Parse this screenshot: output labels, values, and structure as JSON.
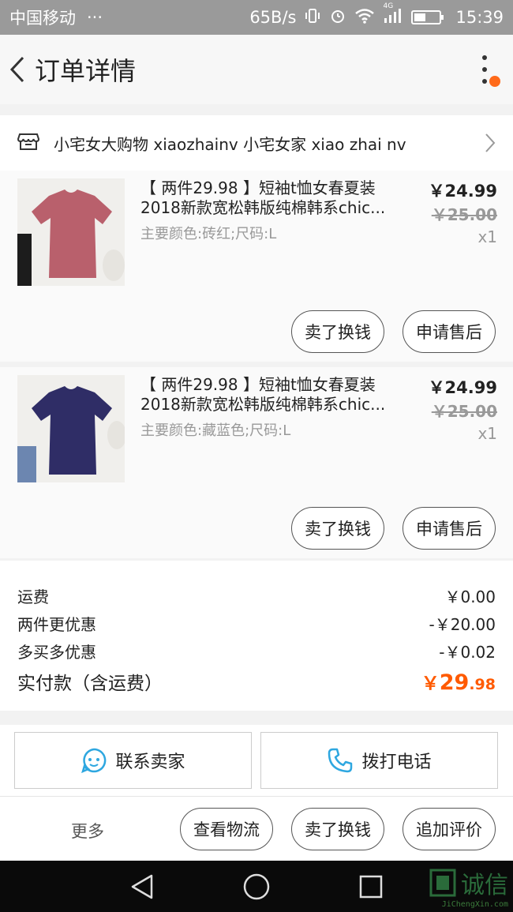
{
  "status_bar": {
    "carrier": "中国移动",
    "dots": "···",
    "speed": "65B/s",
    "network": "4G",
    "time": "15:39"
  },
  "header": {
    "title": "订单详情"
  },
  "shop": {
    "name": "小宅女大购物 xiaozhainv 小宅女家 xiao zhai nv"
  },
  "items": [
    {
      "title_line1": "【 两件29.98 】短袖t恤女春夏装",
      "title_line2": "2018新款宽松韩版纯棉韩系chic...",
      "sku": "主要颜色:砖红;尺码:L",
      "price": "￥24.99",
      "original_price": "￥25.00",
      "quantity": "x1",
      "shirt_color": "#b9606c",
      "btn_sell": "卖了换钱",
      "btn_aftersale": "申请售后"
    },
    {
      "title_line1": "【 两件29.98 】短袖t恤女春夏装",
      "title_line2": "2018新款宽松韩版纯棉韩系chic...",
      "sku": "主要颜色:藏蓝色;尺码:L",
      "price": "￥24.99",
      "original_price": "￥25.00",
      "quantity": "x1",
      "shirt_color": "#2f2d66",
      "btn_sell": "卖了换钱",
      "btn_aftersale": "申请售后"
    }
  ],
  "fees": {
    "shipping_label": "运费",
    "shipping_value": "￥0.00",
    "discount1_label": "两件更优惠",
    "discount1_value": "-￥20.00",
    "discount2_label": "多买多优惠",
    "discount2_value": "-￥0.02",
    "total_label": "实付款（含运费）",
    "total_symbol": "￥",
    "total_int": "29",
    "total_dec": ".98"
  },
  "actions": {
    "contact_seller": "联系卖家",
    "call_phone": "拨打电话"
  },
  "bottom": {
    "more": "更多",
    "logistics": "查看物流",
    "sell": "卖了换钱",
    "review": "追加评价"
  },
  "watermark": {
    "text": "诚信",
    "sub": "JiChengXin.com"
  },
  "colors": {
    "accent_orange": "#ff5a00",
    "icon_blue": "#2ea7e0"
  }
}
